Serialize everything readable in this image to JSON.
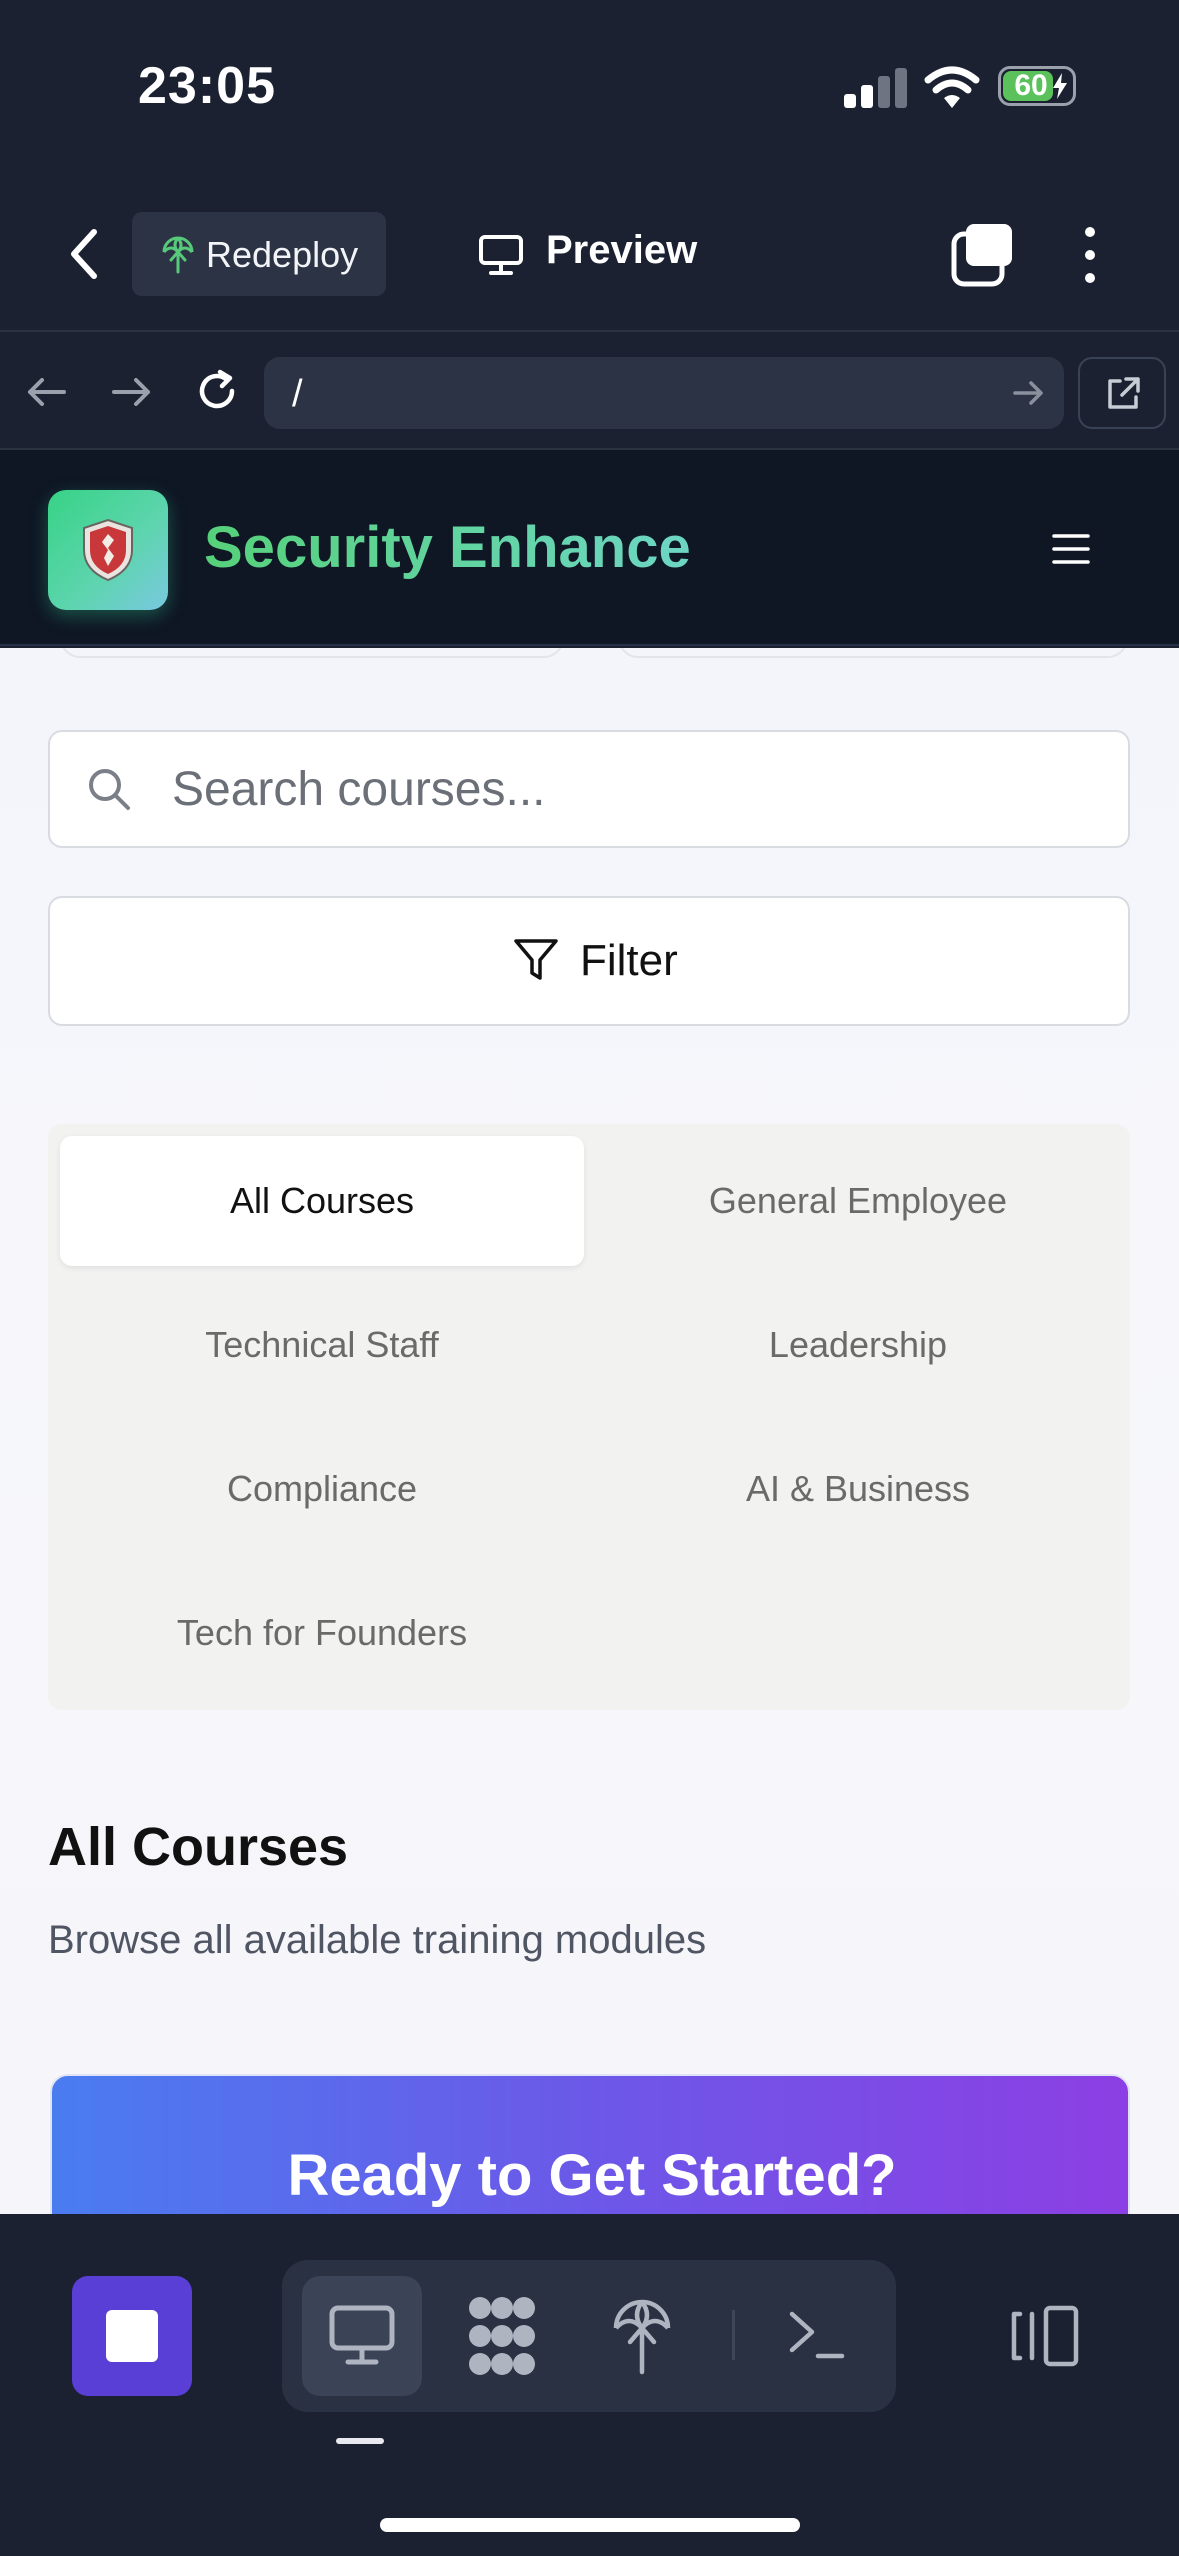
{
  "status_bar": {
    "time": "23:05",
    "battery_percent": "60",
    "signal_bars_active": 2,
    "signal_bars_total": 4
  },
  "top_bar": {
    "redeploy_label": "Redeploy",
    "preview_label": "Preview"
  },
  "browser": {
    "url": "/"
  },
  "app": {
    "brand": "Security Enhance"
  },
  "search": {
    "placeholder": "Search courses..."
  },
  "filter": {
    "label": "Filter"
  },
  "category_tabs": [
    {
      "label": "All Courses",
      "active": true
    },
    {
      "label": "General Employee",
      "active": false
    },
    {
      "label": "Technical Staff",
      "active": false
    },
    {
      "label": "Leadership",
      "active": false
    },
    {
      "label": "Compliance",
      "active": false
    },
    {
      "label": "AI & Business",
      "active": false
    },
    {
      "label": "Tech for Founders",
      "active": false
    }
  ],
  "section": {
    "title": "All Courses",
    "subtitle": "Browse all available training modules"
  },
  "cta": {
    "title": "Ready to Get Started?"
  },
  "colors": {
    "accent": "#5a3fd6",
    "brand_green": "#56d17a",
    "dark_bg": "#1b2131",
    "header_bg": "#0f1624"
  }
}
